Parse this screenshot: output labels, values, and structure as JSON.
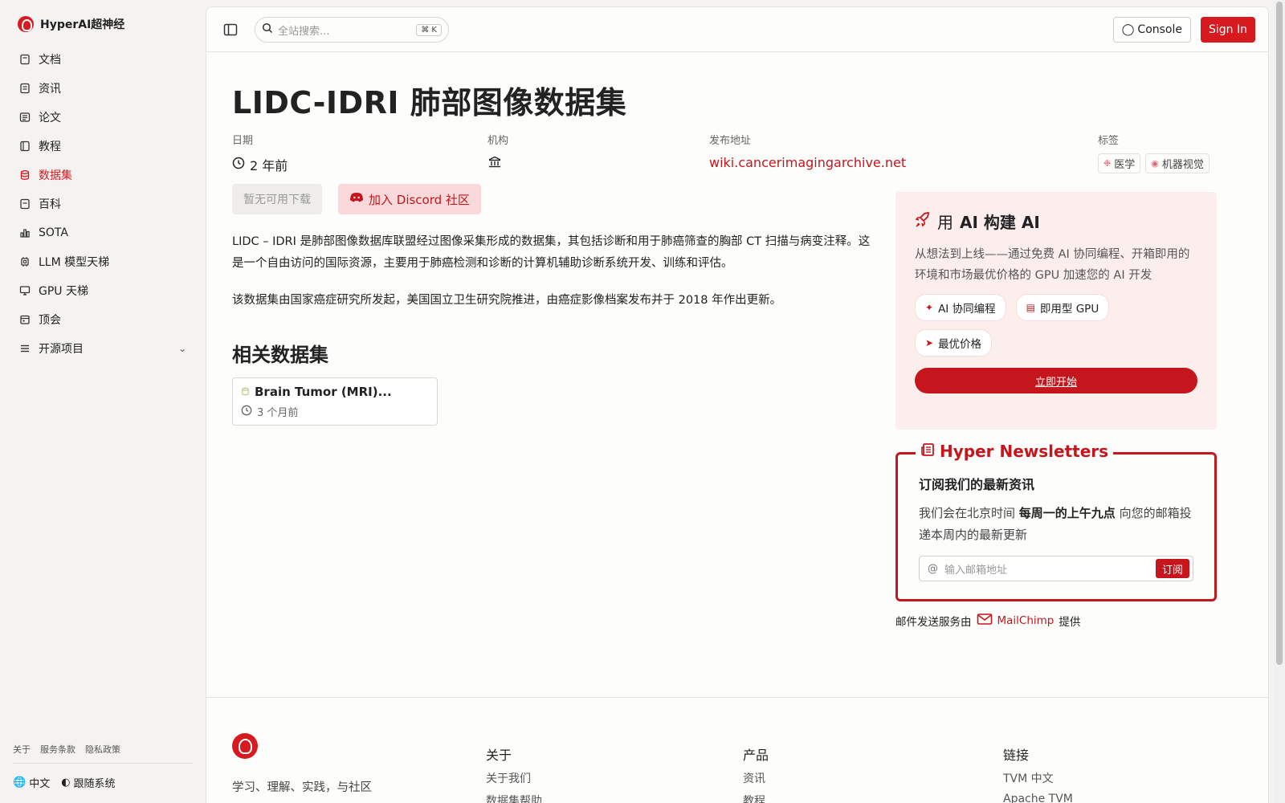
{
  "brand": {
    "name": "HyperAI超神经"
  },
  "sidebar": {
    "items": [
      {
        "label": "文档",
        "icon": "doc-icon",
        "active": false
      },
      {
        "label": "资讯",
        "icon": "news-icon",
        "active": false
      },
      {
        "label": "论文",
        "icon": "paper-icon",
        "active": false
      },
      {
        "label": "教程",
        "icon": "tutorial-icon",
        "active": false
      },
      {
        "label": "数据集",
        "icon": "database-icon",
        "active": true
      },
      {
        "label": "百科",
        "icon": "wiki-icon",
        "active": false
      },
      {
        "label": "SOTA",
        "icon": "chart-icon",
        "active": false
      },
      {
        "label": "LLM 模型天梯",
        "icon": "cpu-icon",
        "active": false
      },
      {
        "label": "GPU 天梯",
        "icon": "monitor-icon",
        "active": false
      },
      {
        "label": "顶会",
        "icon": "calendar-icon",
        "active": false
      },
      {
        "label": "开源项目",
        "icon": "list-icon",
        "active": false
      }
    ],
    "footer_links": [
      "关于",
      "服务条款",
      "隐私政策"
    ],
    "language": "中文",
    "theme": "跟随系统"
  },
  "topbar": {
    "search_placeholder": "全站搜索...",
    "shortcut": "⌘ K",
    "console_label": "Console",
    "signin_label": "Sign In"
  },
  "dataset": {
    "title": "LIDC-IDRI 肺部图像数据集",
    "date_label": "日期",
    "date_value": "2 年前",
    "org_label": "机构",
    "url_label": "发布地址",
    "url_value": "wiki.cancerimagingarchive.net",
    "tags_label": "标签",
    "tags": [
      "医学",
      "机器视觉"
    ],
    "download_label": "暂无可用下载",
    "discord_label": "加入 Discord 社区",
    "desc1": "LIDC – IDRI 是肺部图像数据库联盟经过图像采集形成的数据集，其包括诊断和用于肺癌筛查的胸部 CT 扫描与病变注释。这是一个自由访问的国际资源，主要用于肺癌检测和诊断的计算机辅助诊断系统开发、训练和评估。",
    "desc2": "该数据集由国家癌症研究所发起，美国国立卫生研究院推进，由癌症影像档案发布并于 2018 年作出更新。",
    "related_title": "相关数据集",
    "related": [
      {
        "title": "Brain Tumor (MRI)...",
        "date": "3 个月前"
      }
    ]
  },
  "promo": {
    "title_prefix": "用",
    "title_bold": "AI 构建 AI",
    "desc": "从想法到上线——通过免费 AI 协同编程、开箱即用的环境和市场最优价格的 GPU 加速您的 AI 开发",
    "chips": [
      "AI 协同编程",
      "即用型 GPU",
      "最优价格"
    ],
    "cta": "立即开始"
  },
  "newsletter": {
    "legend": "Hyper Newsletters",
    "subtitle": "订阅我们的最新资讯",
    "desc_pre": "我们会在北京时间",
    "desc_bold": "每周一的上午九点",
    "desc_post": "向您的邮箱投递本周内的最新更新",
    "email_placeholder": "输入邮箱地址",
    "subscribe_label": "订阅",
    "mail_pre": "邮件发送服务由",
    "mail_brand": "MailChimp",
    "mail_post": "提供"
  },
  "footer": {
    "slogan": "学习、理解、实践，与社区",
    "about_head": "关于",
    "about_links": [
      "关于我们",
      "数据集帮助"
    ],
    "product_head": "产品",
    "product_links": [
      "资讯",
      "教程"
    ],
    "links_head": "链接",
    "links_links": [
      "TVM 中文",
      "Apache TVM"
    ]
  },
  "colors": {
    "accent": "#c4161c",
    "brand": "#d71920"
  }
}
